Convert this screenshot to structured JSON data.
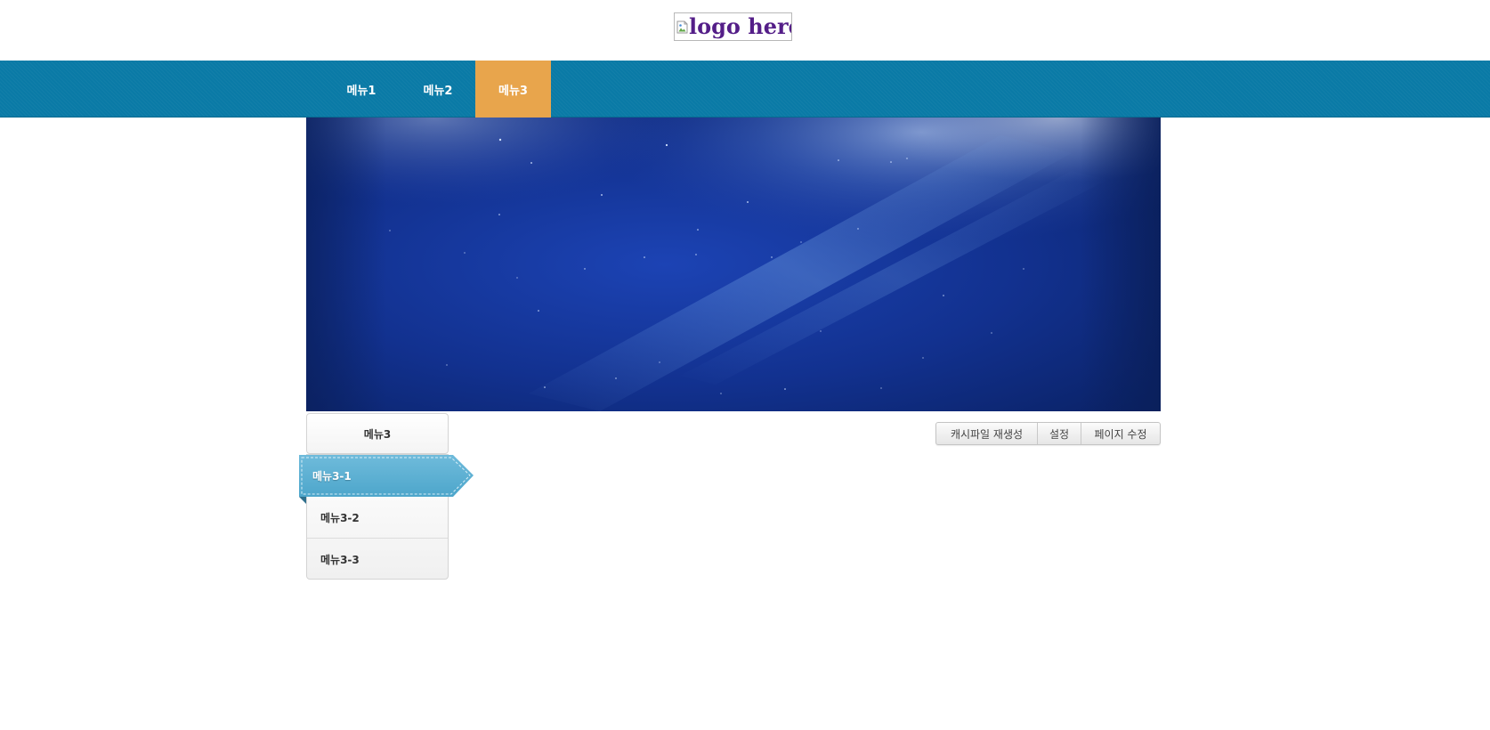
{
  "header": {
    "logo_alt": "logo here"
  },
  "nav": {
    "items": [
      {
        "label": "메뉴1",
        "active": false
      },
      {
        "label": "메뉴2",
        "active": false
      },
      {
        "label": "메뉴3",
        "active": true
      }
    ],
    "background_color": "#0a7aa6",
    "active_color": "#e8a54c"
  },
  "submenu": {
    "title": "메뉴3",
    "items": [
      {
        "label": "메뉴3-1",
        "active": true
      },
      {
        "label": "메뉴3-2",
        "active": false
      },
      {
        "label": "메뉴3-3",
        "active": false
      }
    ],
    "active_color": "#5bb0d2"
  },
  "admin_buttons": {
    "regenerate_cache": "캐시파일 재생성",
    "settings": "설정",
    "edit_page": "페이지 수정"
  }
}
